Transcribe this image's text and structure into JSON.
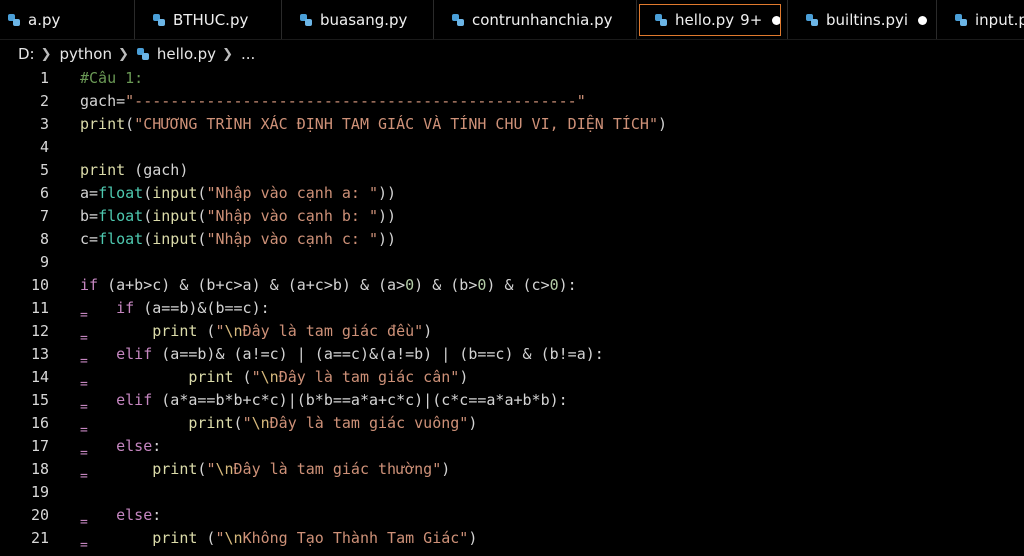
{
  "tabs": [
    {
      "label": "a.py",
      "badge": "",
      "dot": false,
      "active": false
    },
    {
      "label": "BTHUC.py",
      "badge": "",
      "dot": false,
      "active": false
    },
    {
      "label": "buasang.py",
      "badge": "",
      "dot": false,
      "active": false
    },
    {
      "label": "contrunhanchia.py",
      "badge": "",
      "dot": false,
      "active": false
    },
    {
      "label": "hello.py",
      "badge": "9+",
      "dot": true,
      "active": true
    },
    {
      "label": "builtins.pyi",
      "badge": "",
      "dot": true,
      "active": false
    },
    {
      "label": "input.p",
      "badge": "",
      "dot": false,
      "active": false
    }
  ],
  "breadcrumb": {
    "drive": "D:",
    "folder": "python",
    "file": "hello.py",
    "more": "..."
  },
  "colors": {
    "background": "#000000",
    "active_tab_border": "#e07a2e",
    "comment": "#6a9955",
    "keyword": "#c586c0",
    "function": "#dcdcaa",
    "string": "#ce9178",
    "number": "#b5cea8"
  },
  "lines": [
    {
      "n": "1",
      "tokens": [
        {
          "t": "#Câu 1:",
          "c": "comment"
        }
      ]
    },
    {
      "n": "2",
      "tokens": [
        {
          "t": "gach=",
          "c": "def"
        },
        {
          "t": "\"-------------------------------------------------\"",
          "c": "str"
        }
      ]
    },
    {
      "n": "3",
      "tokens": [
        {
          "t": "print",
          "c": "fn"
        },
        {
          "t": "(",
          "c": "def"
        },
        {
          "t": "\"CHƯƠNG TRÌNH XÁC ĐỊNH TAM GIÁC VÀ TÍNH CHU VI, DIỆN TÍCH\"",
          "c": "str"
        },
        {
          "t": ")",
          "c": "def"
        }
      ]
    },
    {
      "n": "4",
      "tokens": []
    },
    {
      "n": "5",
      "tokens": [
        {
          "t": "print",
          "c": "fn"
        },
        {
          "t": " (gach)",
          "c": "def"
        }
      ]
    },
    {
      "n": "6",
      "tokens": [
        {
          "t": "a=",
          "c": "def"
        },
        {
          "t": "float",
          "c": "builtin"
        },
        {
          "t": "(",
          "c": "def"
        },
        {
          "t": "input",
          "c": "fn"
        },
        {
          "t": "(",
          "c": "def"
        },
        {
          "t": "\"Nhập vào cạnh a: \"",
          "c": "str"
        },
        {
          "t": "))",
          "c": "def"
        }
      ]
    },
    {
      "n": "7",
      "tokens": [
        {
          "t": "b=",
          "c": "def"
        },
        {
          "t": "float",
          "c": "builtin"
        },
        {
          "t": "(",
          "c": "def"
        },
        {
          "t": "input",
          "c": "fn"
        },
        {
          "t": "(",
          "c": "def"
        },
        {
          "t": "\"Nhập vào cạnh b: \"",
          "c": "str"
        },
        {
          "t": "))",
          "c": "def"
        }
      ]
    },
    {
      "n": "8",
      "tokens": [
        {
          "t": "c=",
          "c": "def"
        },
        {
          "t": "float",
          "c": "builtin"
        },
        {
          "t": "(",
          "c": "def"
        },
        {
          "t": "input",
          "c": "fn"
        },
        {
          "t": "(",
          "c": "def"
        },
        {
          "t": "\"Nhập vào cạnh c: \"",
          "c": "str"
        },
        {
          "t": "))",
          "c": "def"
        }
      ]
    },
    {
      "n": "9",
      "tokens": []
    },
    {
      "n": "10",
      "tokens": [
        {
          "t": "if",
          "c": "kw"
        },
        {
          "t": " (a+b>c) & (b+c>a) & (a+c>b) & (a>",
          "c": "def"
        },
        {
          "t": "0",
          "c": "num"
        },
        {
          "t": ") & (b>",
          "c": "def"
        },
        {
          "t": "0",
          "c": "num"
        },
        {
          "t": ") & (c>",
          "c": "def"
        },
        {
          "t": "0",
          "c": "num"
        },
        {
          "t": "):",
          "c": "def"
        }
      ]
    },
    {
      "n": "11",
      "mark": true,
      "tokens": [
        {
          "t": "    ",
          "c": "def"
        },
        {
          "t": "if",
          "c": "kw"
        },
        {
          "t": " (a==b)&(b==c):",
          "c": "def"
        }
      ]
    },
    {
      "n": "12",
      "mark": true,
      "tokens": [
        {
          "t": "        ",
          "c": "def"
        },
        {
          "t": "print",
          "c": "fn"
        },
        {
          "t": " (",
          "c": "def"
        },
        {
          "t": "\"",
          "c": "str"
        },
        {
          "t": "\\n",
          "c": "esc"
        },
        {
          "t": "Đây là tam giác đều\"",
          "c": "str"
        },
        {
          "t": ")",
          "c": "def"
        }
      ]
    },
    {
      "n": "13",
      "mark": true,
      "tokens": [
        {
          "t": "    ",
          "c": "def"
        },
        {
          "t": "elif",
          "c": "kw"
        },
        {
          "t": " (a==b)& (a!=c) | (a==c)&(a!=b) | (b==c) & (b!=a):",
          "c": "def"
        }
      ]
    },
    {
      "n": "14",
      "mark": true,
      "tokens": [
        {
          "t": "            ",
          "c": "def"
        },
        {
          "t": "print",
          "c": "fn"
        },
        {
          "t": " (",
          "c": "def"
        },
        {
          "t": "\"",
          "c": "str"
        },
        {
          "t": "\\n",
          "c": "esc"
        },
        {
          "t": "Đây là tam giác cân\"",
          "c": "str"
        },
        {
          "t": ")",
          "c": "def"
        }
      ]
    },
    {
      "n": "15",
      "mark": true,
      "tokens": [
        {
          "t": "    ",
          "c": "def"
        },
        {
          "t": "elif",
          "c": "kw"
        },
        {
          "t": " (a*a==b*b+c*c)|(b*b==a*a+c*c)|(c*c==a*a+b*b):",
          "c": "def"
        }
      ]
    },
    {
      "n": "16",
      "mark": true,
      "tokens": [
        {
          "t": "            ",
          "c": "def"
        },
        {
          "t": "print",
          "c": "fn"
        },
        {
          "t": "(",
          "c": "def"
        },
        {
          "t": "\"",
          "c": "str"
        },
        {
          "t": "\\n",
          "c": "esc"
        },
        {
          "t": "Đây là tam giác vuông\"",
          "c": "str"
        },
        {
          "t": ")",
          "c": "def"
        }
      ]
    },
    {
      "n": "17",
      "mark": true,
      "tokens": [
        {
          "t": "    ",
          "c": "def"
        },
        {
          "t": "else",
          "c": "kw"
        },
        {
          "t": ":",
          "c": "def"
        }
      ]
    },
    {
      "n": "18",
      "mark": true,
      "tokens": [
        {
          "t": "        ",
          "c": "def"
        },
        {
          "t": "print",
          "c": "fn"
        },
        {
          "t": "(",
          "c": "def"
        },
        {
          "t": "\"",
          "c": "str"
        },
        {
          "t": "\\n",
          "c": "esc"
        },
        {
          "t": "Đây là tam giác thường\"",
          "c": "str"
        },
        {
          "t": ")",
          "c": "def"
        }
      ]
    },
    {
      "n": "19",
      "tokens": []
    },
    {
      "n": "20",
      "mark": true,
      "tokens": [
        {
          "t": "    ",
          "c": "def"
        },
        {
          "t": "else",
          "c": "kw"
        },
        {
          "t": ":",
          "c": "def"
        }
      ]
    },
    {
      "n": "21",
      "mark": true,
      "tokens": [
        {
          "t": "        ",
          "c": "def"
        },
        {
          "t": "print",
          "c": "fn"
        },
        {
          "t": " (",
          "c": "def"
        },
        {
          "t": "\"",
          "c": "str"
        },
        {
          "t": "\\n",
          "c": "esc"
        },
        {
          "t": "Không Tạo Thành Tam Giác\"",
          "c": "str"
        },
        {
          "t": ")",
          "c": "def"
        }
      ]
    }
  ],
  "gutter_mark_glyph": "="
}
